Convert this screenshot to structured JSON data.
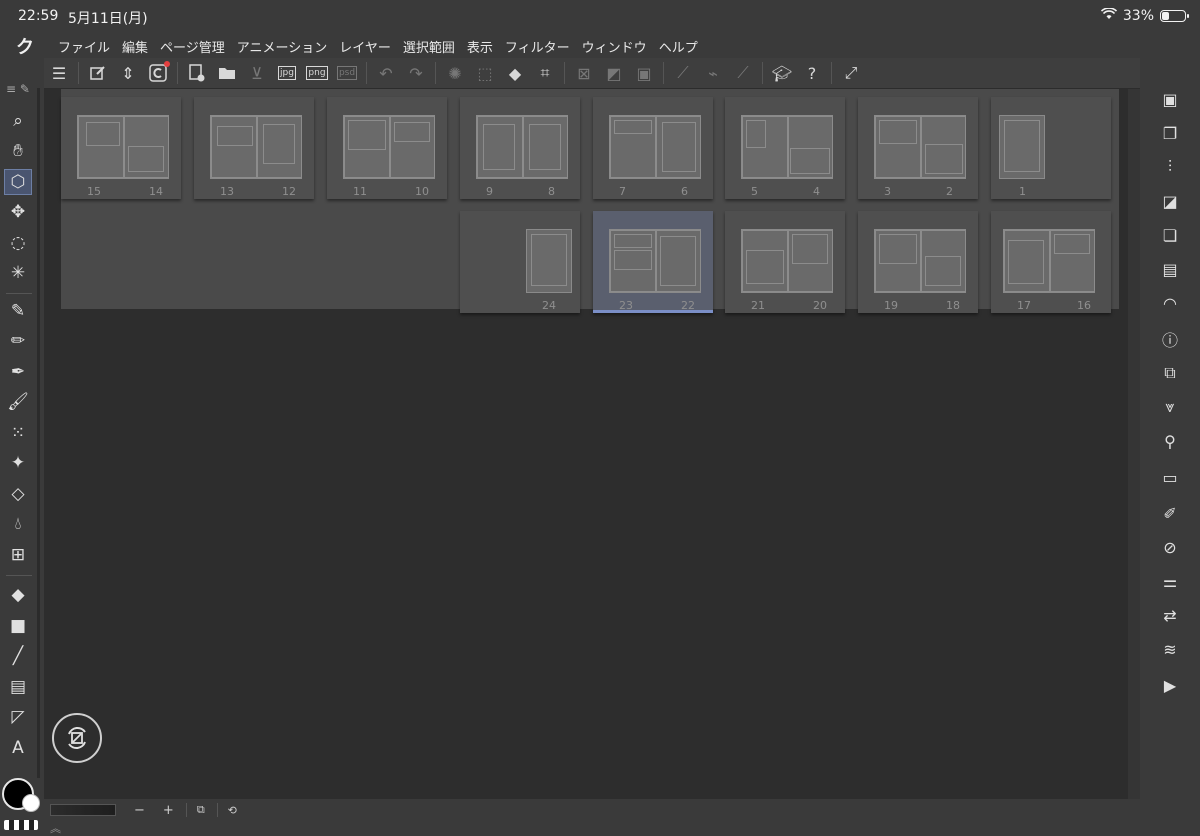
{
  "status": {
    "time": "22:59",
    "date": "5月11日(月)",
    "battery": "33%",
    "battery_level": 0.33
  },
  "menu": {
    "logo": "ク",
    "items": [
      "ファイル",
      "編集",
      "ページ管理",
      "アニメーション",
      "レイヤー",
      "選択範囲",
      "表示",
      "フィルター",
      "ウィンドウ",
      "ヘルプ"
    ]
  },
  "commandbar": {
    "icons": [
      "menu-icon",
      "edit-icon",
      "updown-icon",
      "clip-studio-icon",
      "new-page-icon",
      "open-folder-icon",
      "save-icon",
      "export-jpg-icon",
      "export-png-icon",
      "export-psd-icon",
      "undo-icon",
      "redo-icon",
      "loading-icon",
      "selection-icon",
      "fill-icon",
      "transform-icon",
      "deselect-icon",
      "gradient-icon",
      "crop-icon",
      "ruler-icon",
      "brush-icon",
      "line-icon",
      "learn-icon",
      "help-icon",
      "fullscreen-icon"
    ],
    "labels": {
      "jpg": "jpg",
      "png": "png",
      "psd": "psd"
    }
  },
  "pages": {
    "row1": [
      {
        "left": "15",
        "right": "14"
      },
      {
        "left": "13",
        "right": "12"
      },
      {
        "left": "11",
        "right": "10"
      },
      {
        "left": "9",
        "right": "8"
      },
      {
        "left": "7",
        "right": "6"
      },
      {
        "left": "5",
        "right": "4"
      },
      {
        "left": "3",
        "right": "2"
      },
      {
        "left": "1",
        "right": ""
      }
    ],
    "row2": [
      {
        "left": "24",
        "right": ""
      },
      {
        "left": "23",
        "right": "22"
      },
      {
        "left": "21",
        "right": "20"
      },
      {
        "left": "19",
        "right": "18"
      },
      {
        "left": "17",
        "right": "16"
      }
    ],
    "selected": "23-22"
  },
  "lefttools": [
    "list-icon",
    "zoom-icon",
    "hand-icon",
    "object-select-icon",
    "move-icon",
    "lasso-icon",
    "magic-wand-icon",
    "pen-icon",
    "pencil-icon",
    "fountain-pen-icon",
    "brush-icon",
    "airbrush-icon",
    "decoration-icon",
    "eraser-icon",
    "blend-icon",
    "perspective-icon",
    "fill-bucket-icon",
    "gradient-icon",
    "line-icon",
    "frame-icon",
    "balloon-icon",
    "text-icon"
  ],
  "righticons": [
    "navigator-icon",
    "layers-alt-icon",
    "adjust-icon",
    "color-icon",
    "subview-icon",
    "material-icon",
    "chat-icon",
    "info-icon",
    "3d-layers-icon",
    "layer-search-icon",
    "idea-icon",
    "timeline-icon",
    "pen-settings-icon",
    "history-icon",
    "sliders-icon",
    "linked-icon",
    "layers-icon",
    "animation-icon"
  ],
  "bottombar": {
    "minus": "−",
    "plus": "+"
  },
  "colors": {
    "main": "#000000",
    "sub": "#ffffff",
    "accent": "#7b8fc7"
  }
}
